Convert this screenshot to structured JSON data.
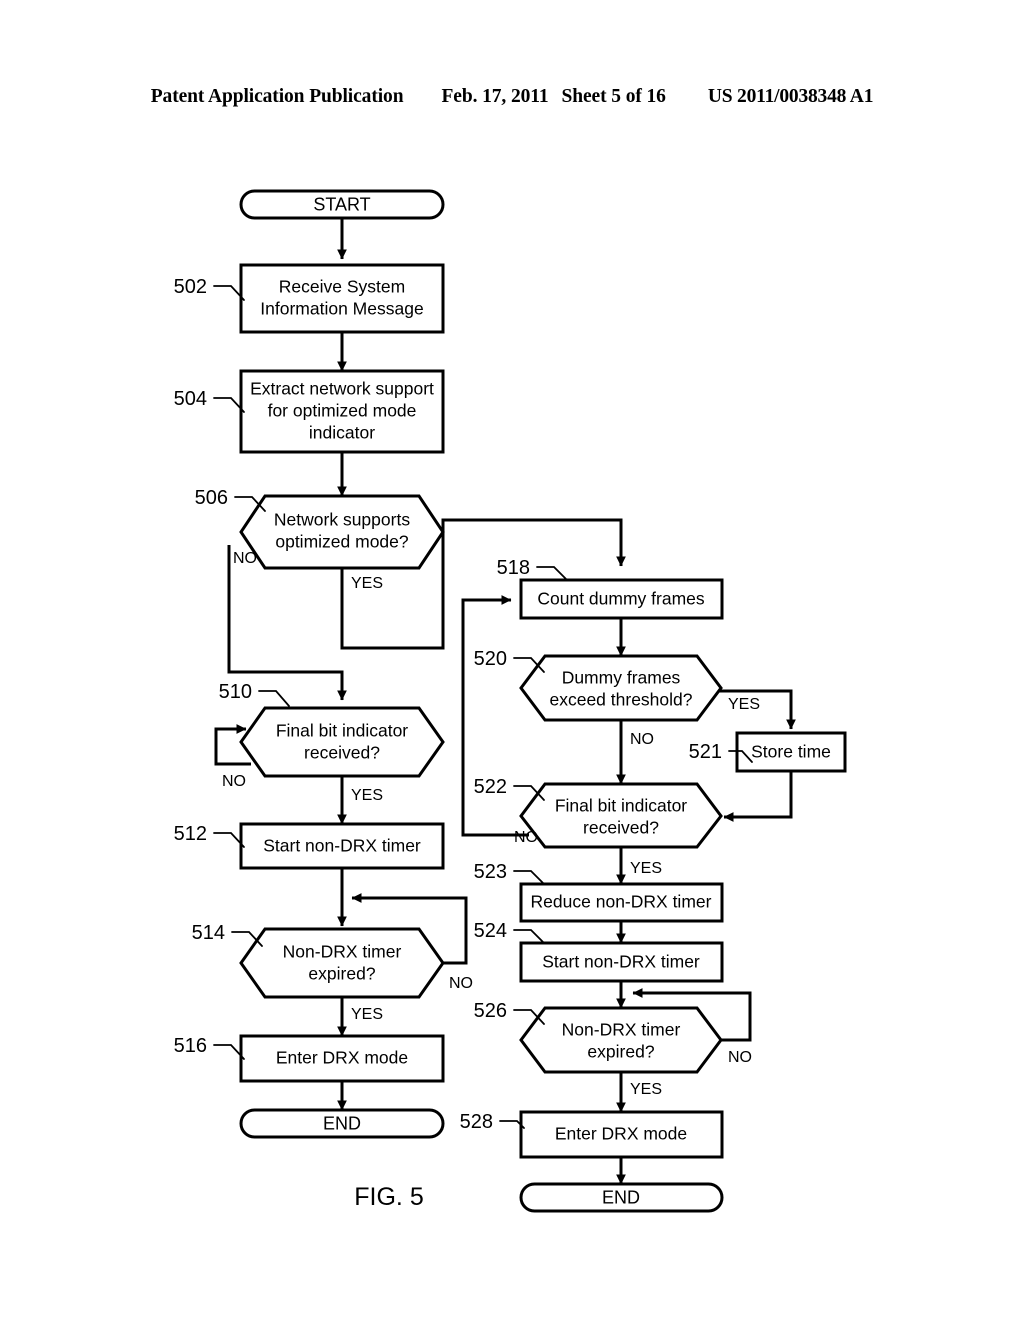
{
  "header": {
    "publication": "Patent Application Publication",
    "date": "Feb. 17, 2011",
    "sheet": "Sheet 5 of 16",
    "patent_number": "US 2011/0038348 A1"
  },
  "figure": {
    "caption": "FIG. 5",
    "branch_yes": "YES",
    "branch_no": "NO"
  },
  "nodes": {
    "start_left": {
      "ref": "",
      "label": "START"
    },
    "n502": {
      "ref": "502",
      "label_line1": "Receive System",
      "label_line2": "Information Message"
    },
    "n504": {
      "ref": "504",
      "label_line1": "Extract network support",
      "label_line2": "for optimized mode",
      "label_line3": "indicator"
    },
    "n506": {
      "ref": "506",
      "label_line1": "Network supports",
      "label_line2": "optimized mode?"
    },
    "n510": {
      "ref": "510",
      "label_line1": "Final bit indicator",
      "label_line2": "received?"
    },
    "n512": {
      "ref": "512",
      "label": "Start non-DRX timer"
    },
    "n514": {
      "ref": "514",
      "label_line1": "Non-DRX timer",
      "label_line2": "expired?"
    },
    "n516": {
      "ref": "516",
      "label": "Enter DRX mode"
    },
    "end_left": {
      "ref": "",
      "label": "END"
    },
    "n518": {
      "ref": "518",
      "label": "Count dummy frames"
    },
    "n520": {
      "ref": "520",
      "label_line1": "Dummy frames",
      "label_line2": "exceed threshold?"
    },
    "n521": {
      "ref": "521",
      "label": "Store time"
    },
    "n522": {
      "ref": "522",
      "label_line1": "Final bit indicator",
      "label_line2": "received?"
    },
    "n523": {
      "ref": "523",
      "label": "Reduce non-DRX timer"
    },
    "n524": {
      "ref": "524",
      "label": "Start non-DRX timer"
    },
    "n526": {
      "ref": "526",
      "label_line1": "Non-DRX timer",
      "label_line2": "expired?"
    },
    "n528": {
      "ref": "528",
      "label": "Enter DRX mode"
    },
    "end_right": {
      "ref": "",
      "label": "END"
    }
  },
  "branch_labels": {
    "b506_no": "NO",
    "b506_yes": "YES",
    "b510_no": "NO",
    "b510_yes": "YES",
    "b514_no": "NO",
    "b514_yes": "YES",
    "b520_yes": "YES",
    "b520_no": "NO",
    "b522_no": "NO",
    "b522_yes": "YES",
    "b526_no": "NO",
    "b526_yes": "YES"
  },
  "colors": {
    "ink": "#000000",
    "paper": "#ffffff"
  }
}
